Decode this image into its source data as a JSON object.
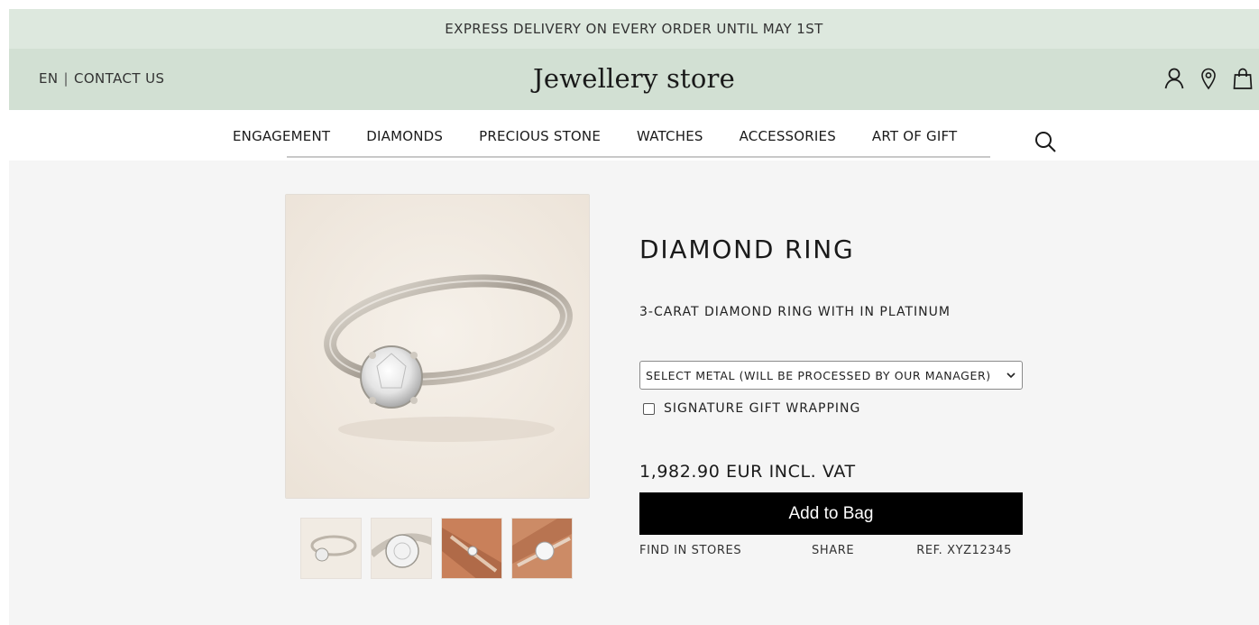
{
  "promo": {
    "text": "Express delivery on every order until May 1st"
  },
  "header": {
    "language": "EN",
    "separator": "|",
    "contact": "Contact us",
    "store_name": "Jewellery store",
    "icons": [
      "user-icon",
      "location-pin-icon",
      "shopping-bag-icon"
    ]
  },
  "nav": {
    "items": [
      "Engagement",
      "Diamonds",
      "Precious stone",
      "Watches",
      "Accessories",
      "Art of gift"
    ],
    "search_icon": "search-icon"
  },
  "product": {
    "title": "Diamond ring",
    "subtitle": "3-carat diamond ring with in platinum",
    "metal_select": {
      "selected": "Select metal (will be processed by our manager)"
    },
    "gift_wrapping": {
      "label": "Signature gift wrapping",
      "checked": false
    },
    "price": "1,982.90 EUR incl. VAT",
    "add_button": "Add to Bag",
    "find_in_stores": "Find in stores",
    "share": "Share",
    "ref": "Ref. XYZ12345"
  },
  "colors": {
    "promo_bg": "#dde8de",
    "header_bg": "#d2e0d3",
    "content_bg": "#f5f5f5",
    "button_bg": "#000000",
    "button_text": "#ffffff"
  }
}
